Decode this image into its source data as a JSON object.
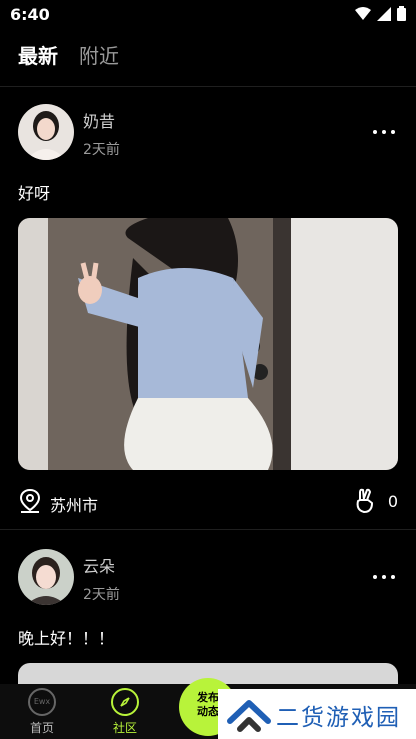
{
  "status_bar": {
    "time": "6:40"
  },
  "tabs": {
    "latest": "最新",
    "nearby": "附近"
  },
  "posts": [
    {
      "username": "奶昔",
      "time": "2天前",
      "text": "好呀",
      "location": "苏州市",
      "likes": "0"
    },
    {
      "username": "云朵",
      "time": "2天前",
      "text": "晚上好！！！"
    }
  ],
  "bottom_nav": {
    "home_label": "首页",
    "community_label": "社区",
    "publish_label_line1": "发布",
    "publish_label_line2": "动态",
    "home_icon_text": "Ewx"
  },
  "watermark": {
    "text": "二货游戏园"
  },
  "colors": {
    "accent": "#b8f33a",
    "background": "#000000",
    "muted_text": "#9a9a9a",
    "watermark_blue": "#1f5fb5"
  }
}
